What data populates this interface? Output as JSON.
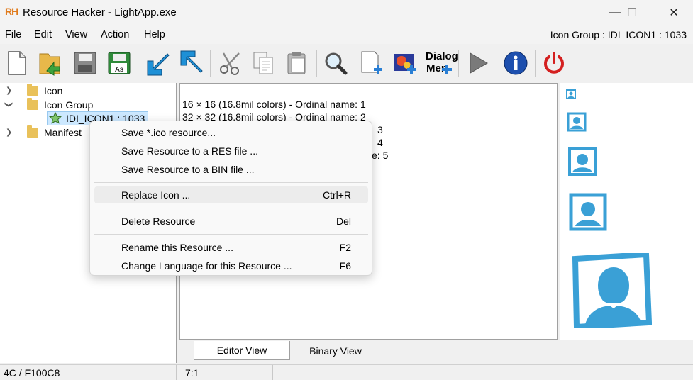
{
  "window": {
    "logo": "RH",
    "title": "Resource Hacker - LightApp.exe",
    "minimize": "—",
    "maximize": "☐",
    "close": "✕"
  },
  "menu": {
    "items": [
      "File",
      "Edit",
      "View",
      "Action",
      "Help"
    ],
    "right_status": "Icon Group : IDI_ICON1 : 1033"
  },
  "toolbar": {
    "dialog_label_1": "Dialog",
    "dialog_label_2": "Mer"
  },
  "tree": {
    "items": [
      {
        "label": "Icon",
        "expanded": false
      },
      {
        "label": "Icon Group",
        "expanded": true
      },
      {
        "label": "IDI_ICON1 : 1033",
        "selected": true
      },
      {
        "label": "Manifest",
        "expanded": false
      }
    ]
  },
  "editor": {
    "lines": [
      "16 × 16 (16.8mil colors) - Ordinal name: 1",
      "32 × 32 (16.8mil colors) - Ordinal name: 2",
      "3",
      "4",
      "e: 5"
    ]
  },
  "tabs": [
    {
      "label": "Editor View",
      "active": true
    },
    {
      "label": "Binary View",
      "active": false
    }
  ],
  "status": {
    "left": "4C / F100C8",
    "right": "7:1"
  },
  "context_menu": {
    "items": [
      {
        "label": "Save *.ico resource...",
        "shortcut": ""
      },
      {
        "label": "Save Resource to a RES file ...",
        "shortcut": ""
      },
      {
        "label": "Save Resource to a BIN file ...",
        "shortcut": ""
      },
      {
        "label": "Replace Icon ...",
        "shortcut": "Ctrl+R",
        "highlighted": true
      },
      {
        "label": "Delete Resource",
        "shortcut": "Del"
      },
      {
        "label": "Rename this Resource ...",
        "shortcut": "F2"
      },
      {
        "label": "Change Language for this Resource ...",
        "shortcut": "F6"
      }
    ]
  },
  "colors": {
    "accent": "#3aa0d6",
    "selection": "#cce8ff",
    "menu_hover": "#ececec"
  }
}
